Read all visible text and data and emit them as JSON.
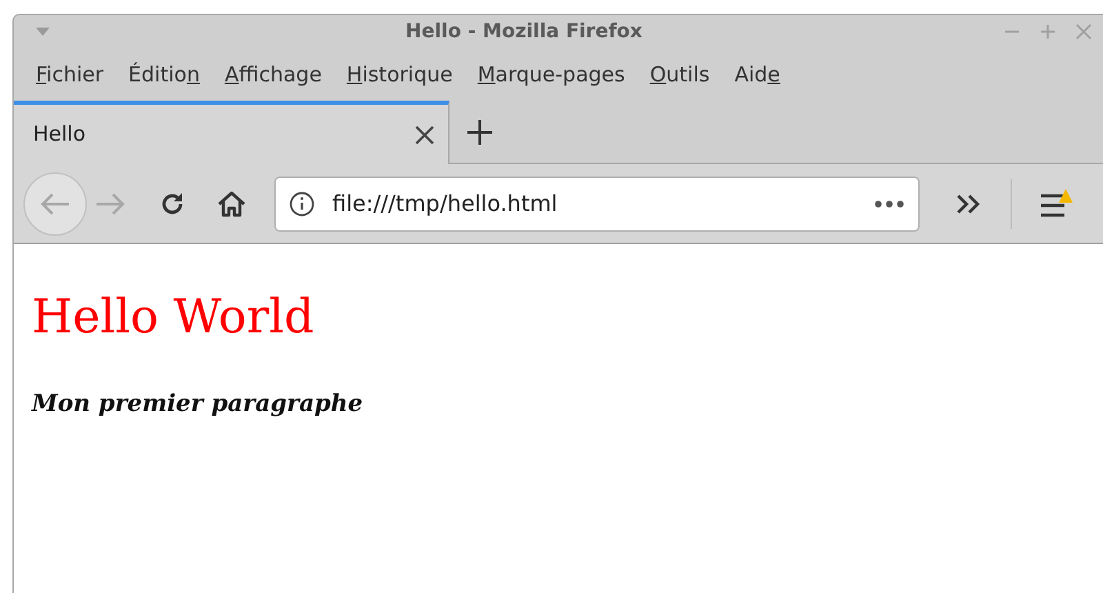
{
  "window": {
    "title": "Hello - Mozilla Firefox"
  },
  "menu": [
    {
      "key": "F",
      "after": "ichier"
    },
    {
      "before": "Éditio",
      "key": "n"
    },
    {
      "key": "A",
      "after": "ffichage"
    },
    {
      "key": "H",
      "after": "istorique"
    },
    {
      "key": "M",
      "after": "arque-pages"
    },
    {
      "key": "O",
      "after": "utils"
    },
    {
      "before": "Aid",
      "key": "e"
    }
  ],
  "tabs": [
    {
      "label": "Hello",
      "selected": true
    }
  ],
  "nav": {
    "back": {
      "disabled": true
    },
    "forward": {
      "disabled": true
    }
  },
  "address": {
    "value": "file:///tmp/hello.html"
  },
  "menu_button": {
    "warning": true
  },
  "page": {
    "heading": "Hello World",
    "paragraph": "Mon premier paragraphe"
  }
}
